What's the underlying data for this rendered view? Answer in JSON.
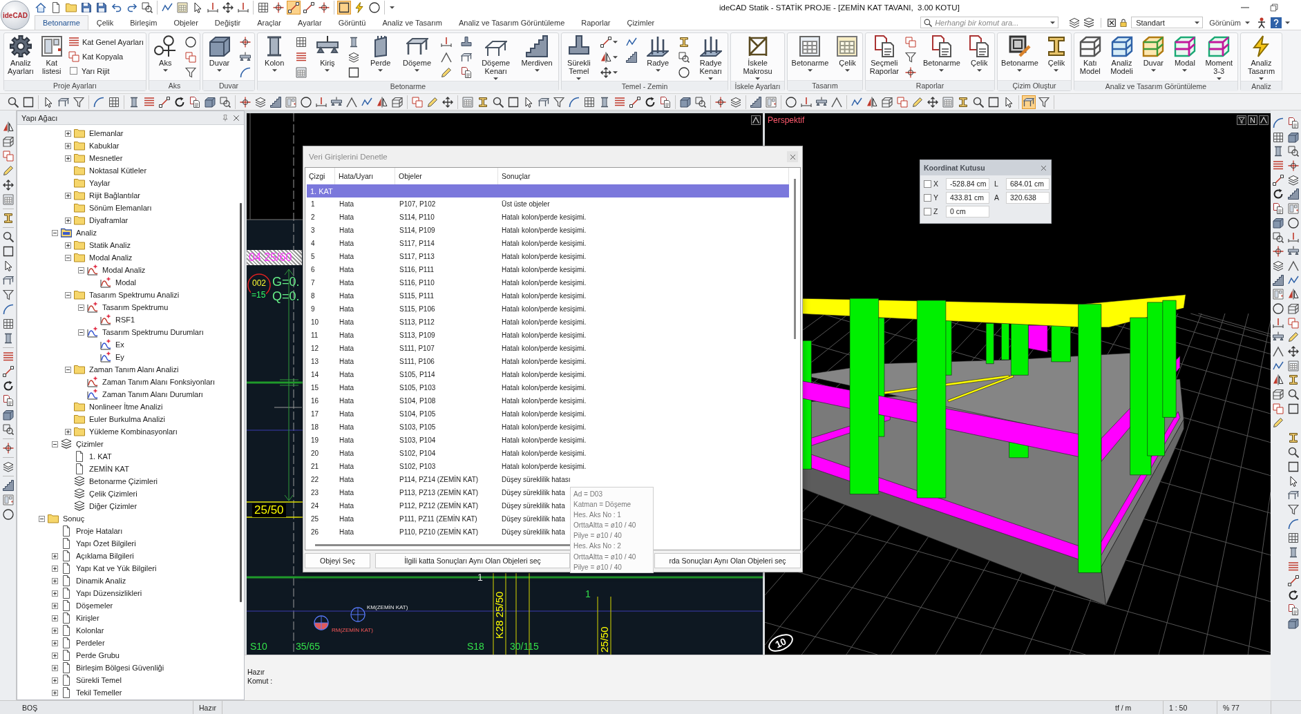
{
  "app": {
    "logo": "ideCAD",
    "title": "ideCAD Statik - STATİK PROJE - [ZEMİN KAT TAVANI,  3.00 KOTU]"
  },
  "quick_access_toolbar": {
    "groups": [
      {
        "buttons": [
          {
            "on": false
          },
          {
            "on": false
          },
          {
            "on": false
          },
          {
            "on": false
          },
          {
            "on": false
          },
          {
            "on": false
          },
          {
            "on": false
          },
          {
            "on": false
          }
        ]
      },
      {
        "buttons": [
          {
            "on": false
          },
          {
            "on": false
          },
          {
            "on": false
          },
          {
            "on": false
          },
          {
            "on": false
          },
          {
            "on": false
          }
        ]
      },
      {
        "buttons": [
          {
            "on": false
          },
          {
            "on": false
          },
          {
            "on": true
          },
          {
            "on": false
          },
          {
            "on": false
          }
        ]
      },
      {
        "buttons": [
          {
            "on": true
          },
          {
            "on": false
          },
          {
            "on": false
          }
        ]
      }
    ]
  },
  "ribbon_tabs": [
    {
      "label": "Betonarme",
      "selected": true
    },
    {
      "label": "Çelik",
      "selected": false
    },
    {
      "label": "Birleşim",
      "selected": false
    },
    {
      "label": "Objeler",
      "selected": false
    },
    {
      "label": "Değiştir",
      "selected": false
    },
    {
      "label": "Araçlar",
      "selected": false
    },
    {
      "label": "Ayarlar",
      "selected": false
    },
    {
      "label": "Görüntü",
      "selected": false
    },
    {
      "label": "Analiz ve Tasarım",
      "selected": false
    },
    {
      "label": "Analiz ve Tasarım Görüntüleme",
      "selected": false
    },
    {
      "label": "Raporlar",
      "selected": false
    },
    {
      "label": "Çizimler",
      "selected": false
    }
  ],
  "command_search": {
    "placeholder": "Herhangi bir komut ara..."
  },
  "style_selector": {
    "value": "Standart"
  },
  "view_menu": {
    "label": "Görünüm"
  },
  "ribbon_groups": [
    {
      "title": "Proje Ayarları",
      "items": [
        {
          "kind": "large",
          "label": "Analiz Ayarları",
          "dropdown": false
        },
        {
          "kind": "large",
          "label": "Kat listesi",
          "dropdown": false
        },
        {
          "kind": "stack",
          "rows": [
            {
              "kind": "small",
              "label": "Kat Genel Ayarları"
            },
            {
              "kind": "small",
              "label": "Kat Kopyala"
            },
            {
              "kind": "check",
              "label": "Yarı Rijit",
              "checked": false
            }
          ]
        }
      ]
    },
    {
      "title": "Aks",
      "items": [
        {
          "kind": "large",
          "label": "Aks",
          "dropdown": true
        },
        {
          "kind": "icon_column",
          "buttons": [
            {
              "dropdown": false
            },
            {
              "dropdown": false
            },
            {
              "dropdown": false
            }
          ]
        }
      ]
    },
    {
      "title": "Duvar",
      "items": [
        {
          "kind": "large",
          "label": "Duvar",
          "dropdown": true
        },
        {
          "kind": "icon_column",
          "buttons": [
            {
              "dropdown": false
            },
            {
              "dropdown": false
            },
            {
              "dropdown": false
            }
          ]
        }
      ]
    },
    {
      "title": "Betonarme",
      "items": [
        {
          "kind": "large",
          "label": "Kolon",
          "dropdown": true
        },
        {
          "kind": "icon_column",
          "buttons": [
            {
              "dropdown": false
            },
            {
              "dropdown": false
            },
            {
              "dropdown": false
            }
          ]
        },
        {
          "kind": "large",
          "label": "Kiriş",
          "dropdown": true
        },
        {
          "kind": "icon_column",
          "buttons": [
            {
              "dropdown": false
            },
            {
              "dropdown": false
            },
            {
              "dropdown": false
            }
          ]
        },
        {
          "kind": "large",
          "label": "Perde",
          "dropdown": true
        },
        {
          "kind": "large",
          "label": "Döşeme",
          "dropdown": true
        },
        {
          "kind": "icon_column",
          "buttons": [
            {
              "dropdown": false
            },
            {
              "dropdown": false
            },
            {
              "dropdown": false
            }
          ]
        },
        {
          "kind": "icon_column",
          "buttons": [
            {
              "dropdown": false
            },
            {
              "dropdown": false
            },
            {
              "dropdown": false
            }
          ]
        },
        {
          "kind": "large",
          "label": "Döşeme Kenarı",
          "dropdown": true
        },
        {
          "kind": "large",
          "label": "Merdiven",
          "dropdown": true
        }
      ]
    },
    {
      "title": "Temel - Zemin",
      "items": [
        {
          "kind": "large",
          "label": "Sürekli Temel",
          "dropdown": true
        },
        {
          "kind": "icon_column",
          "buttons": [
            {
              "dropdown": true
            },
            {
              "dropdown": true
            },
            {
              "dropdown": true
            }
          ]
        },
        {
          "kind": "icon_column",
          "buttons": [
            {
              "dropdown": false
            },
            {
              "dropdown": false
            }
          ]
        },
        {
          "kind": "large",
          "label": "Radye",
          "dropdown": true
        },
        {
          "kind": "icon_column",
          "buttons": [
            {
              "dropdown": false
            },
            {
              "dropdown": false
            },
            {
              "dropdown": false
            }
          ]
        },
        {
          "kind": "large",
          "label": "Radye Kenarı",
          "dropdown": true
        }
      ]
    },
    {
      "title": "İskele Ayarları",
      "items": [
        {
          "kind": "large",
          "label": "İskele Makrosu",
          "dropdown": true
        }
      ]
    },
    {
      "title": "Tasarım",
      "items": [
        {
          "kind": "large",
          "label": "Betonarme",
          "dropdown": true
        },
        {
          "kind": "large",
          "label": "Çelik",
          "dropdown": true
        }
      ]
    },
    {
      "title": "Raporlar",
      "items": [
        {
          "kind": "large",
          "label": "Seçmeli Raporlar",
          "dropdown": false
        },
        {
          "kind": "icon_column",
          "buttons": [
            {
              "dropdown": false
            },
            {
              "dropdown": false
            },
            {
              "dropdown": false
            }
          ]
        },
        {
          "kind": "large",
          "label": "Betonarme",
          "dropdown": true
        },
        {
          "kind": "large",
          "label": "Çelik",
          "dropdown": true
        }
      ]
    },
    {
      "title": "Çizim Oluştur",
      "items": [
        {
          "kind": "large",
          "label": "Betonarme",
          "dropdown": true
        },
        {
          "kind": "large",
          "label": "Çelik",
          "dropdown": true
        }
      ]
    },
    {
      "title": "Analiz ve Tasarım Görüntüleme",
      "items": [
        {
          "kind": "large",
          "label": "Katı Model",
          "dropdown": false
        },
        {
          "kind": "large",
          "label": "Analiz Modeli",
          "dropdown": false
        },
        {
          "kind": "large",
          "label": "Duvar",
          "dropdown": true
        },
        {
          "kind": "large",
          "label": "Modal",
          "dropdown": true
        },
        {
          "kind": "large",
          "label": "Moment 3-3",
          "dropdown": true
        }
      ]
    },
    {
      "title": "Analiz",
      "items": [
        {
          "kind": "large",
          "label": "Analiz Tasarım",
          "dropdown": true
        }
      ]
    }
  ],
  "toolbar": {
    "groups": [
      {
        "buttons": [
          {
            "on": false
          },
          {
            "on": false
          }
        ]
      },
      {
        "buttons": [
          {
            "on": false
          },
          {
            "on": false
          },
          {
            "on": false
          }
        ]
      },
      {
        "buttons": [
          {
            "on": false
          },
          {
            "on": false
          }
        ]
      },
      {
        "buttons": [
          {
            "on": false
          },
          {
            "on": false
          },
          {
            "on": false
          },
          {
            "on": false
          },
          {
            "on": false
          },
          {
            "on": false
          },
          {
            "on": false
          }
        ]
      },
      {
        "buttons": [
          {
            "on": false
          },
          {
            "on": false
          },
          {
            "on": false
          },
          {
            "on": false
          },
          {
            "on": false
          },
          {
            "on": false
          },
          {
            "on": false
          },
          {
            "on": false
          },
          {
            "on": false
          },
          {
            "on": false
          },
          {
            "on": false
          }
        ]
      },
      {
        "buttons": [
          {
            "on": false
          },
          {
            "on": false
          },
          {
            "on": false
          }
        ]
      },
      {
        "buttons": [
          {
            "on": false
          },
          {
            "on": false
          },
          {
            "on": false
          },
          {
            "on": false
          },
          {
            "on": false
          },
          {
            "on": false
          },
          {
            "on": false
          },
          {
            "on": false
          },
          {
            "on": false
          },
          {
            "on": false
          },
          {
            "on": false
          },
          {
            "on": false
          },
          {
            "on": false
          },
          {
            "on": false
          }
        ]
      },
      {
        "buttons": [
          {
            "on": false
          },
          {
            "on": false
          }
        ]
      },
      {
        "buttons": [
          {
            "on": false
          },
          {
            "on": false
          }
        ]
      },
      {
        "buttons": [
          {
            "on": false
          },
          {
            "on": false
          }
        ]
      },
      {
        "buttons": [
          {
            "on": false
          },
          {
            "on": false
          },
          {
            "on": false
          },
          {
            "on": false
          }
        ]
      },
      {
        "buttons": [
          {
            "on": false
          },
          {
            "on": false
          },
          {
            "on": false
          },
          {
            "on": false
          },
          {
            "on": false
          },
          {
            "on": false
          },
          {
            "on": false
          },
          {
            "on": false
          },
          {
            "on": false
          },
          {
            "on": false
          },
          {
            "on": false
          }
        ]
      },
      {
        "buttons": [
          {
            "on": true
          },
          {
            "on": false
          }
        ]
      }
    ]
  },
  "tree": {
    "title": "Yapı Ağacı",
    "items": [
      {
        "children": [
          {
            "children": [
              {
                "label": "Elemanlar",
                "kind": "folder",
                "expanded": false
              },
              {
                "label": "Kabuklar",
                "kind": "folder",
                "expanded": false
              },
              {
                "label": "Mesnetler",
                "kind": "folder",
                "expanded": false
              },
              {
                "label": "Noktasal Kütleler",
                "kind": "folder"
              },
              {
                "label": "Yaylar",
                "kind": "folder"
              },
              {
                "label": "Rijit Bağlantılar",
                "kind": "folder",
                "expanded": false
              },
              {
                "label": "Sönüm Elemanları",
                "kind": "folder"
              },
              {
                "label": "Diyaframlar",
                "kind": "folder",
                "expanded": false
              }
            ]
          },
          {
            "label": "Analiz",
            "kind": "analysis",
            "expanded": true,
            "children": [
              {
                "label": "Statik Analiz",
                "kind": "folder",
                "expanded": false
              },
              {
                "label": "Modal Analiz",
                "kind": "folder",
                "expanded": true,
                "children": [
                  {
                    "label": "Modal Analiz",
                    "kind": "function",
                    "expanded": true,
                    "children": [
                      {
                        "label": "Modal",
                        "kind": "function"
                      }
                    ]
                  }
                ]
              },
              {
                "label": "Tasarım Spektrumu Analizi",
                "kind": "folder",
                "expanded": true,
                "children": [
                  {
                    "label": "Tasarım Spektrumu",
                    "kind": "function",
                    "expanded": true,
                    "children": [
                      {
                        "label": "RSF1",
                        "kind": "function"
                      }
                    ]
                  },
                  {
                    "label": "Tasarım Spektrumu Durumları",
                    "kind": "case",
                    "expanded": true,
                    "children": [
                      {
                        "label": "Ex",
                        "kind": "case"
                      },
                      {
                        "label": "Ey",
                        "kind": "case"
                      }
                    ]
                  }
                ]
              },
              {
                "label": "Zaman Tanım Alanı Analizi",
                "kind": "folder",
                "expanded": true,
                "children": [
                  {
                    "label": "Zaman Tanım Alanı Fonksiyonları",
                    "kind": "function"
                  },
                  {
                    "label": "Zaman Tanım Alanı Durumları",
                    "kind": "case"
                  }
                ]
              },
              {
                "label": "Nonlineer İtme Analizi",
                "kind": "folder"
              },
              {
                "label": "Euler Burkulma Analizi",
                "kind": "folder"
              },
              {
                "label": "Yükleme Kombinasyonları",
                "kind": "folder",
                "expanded": false
              }
            ]
          },
          {
            "label": "Çizimler",
            "kind": "drawing-set",
            "expanded": true,
            "children": [
              {
                "label": "1. KAT",
                "kind": "sheet"
              },
              {
                "label": "ZEMİN KAT",
                "kind": "sheet"
              },
              {
                "label": "Betonarme Çizimleri",
                "kind": "drawing-set"
              },
              {
                "label": "Çelik Çizimleri",
                "kind": "drawing-set"
              },
              {
                "label": "Diğer Çizimler",
                "kind": "drawing-set"
              }
            ]
          }
        ]
      },
      {
        "label": "Sonuç",
        "kind": "folder",
        "expanded": true,
        "children": [
          {
            "label": "Proje Hataları",
            "kind": "report"
          },
          {
            "label": "Yapı Özet Bilgileri",
            "kind": "report"
          },
          {
            "label": "Açıklama Bilgileri",
            "kind": "report",
            "expanded": false
          },
          {
            "label": "Yapı Kat ve Yük Bilgileri",
            "kind": "report",
            "expanded": false
          },
          {
            "label": "Dinamik Analiz",
            "kind": "report",
            "expanded": false
          },
          {
            "label": "Yapı Düzensizlikleri",
            "kind": "report",
            "expanded": false
          },
          {
            "label": "Döşemeler",
            "kind": "report",
            "expanded": false
          },
          {
            "label": "Kirişler",
            "kind": "report",
            "expanded": false
          },
          {
            "label": "Kolonlar",
            "kind": "report",
            "expanded": false
          },
          {
            "label": "Perdeler",
            "kind": "report",
            "expanded": false
          },
          {
            "label": "Perde Grubu",
            "kind": "report",
            "expanded": false
          },
          {
            "label": "Birleşim Bölgesi Güvenliği",
            "kind": "report",
            "expanded": false
          },
          {
            "label": "Sürekli Temel",
            "kind": "report",
            "expanded": false
          },
          {
            "label": "Tekil Temeller",
            "kind": "report",
            "expanded": false
          }
        ]
      }
    ]
  },
  "plan_view": {
    "labels": [
      {
        "text": "04 25/60",
        "kind": "hatched"
      },
      {
        "text": "002",
        "kind": "slab-no"
      },
      {
        "text": "=15",
        "kind": "slab-value"
      },
      {
        "text": "G=0.",
        "kind": "load"
      },
      {
        "text": "Q=0.",
        "kind": "load"
      },
      {
        "text": "25/50",
        "kind": "boxed"
      },
      {
        "text": "1",
        "kind": "note"
      },
      {
        "text": "KM(ZEMİN KAT)",
        "kind": "km-mark"
      },
      {
        "text": "1",
        "kind": "dim"
      },
      {
        "text": "RM(ZEMİN KAT)",
        "kind": "rm-mark"
      },
      {
        "text": "K28 25/50",
        "kind": "vertical"
      },
      {
        "text": "25/50",
        "kind": "vertical"
      },
      {
        "text": "S10",
        "kind": "column"
      },
      {
        "text": "35/65",
        "kind": "column"
      },
      {
        "text": "S18",
        "kind": "column"
      },
      {
        "text": "30/115",
        "kind": "column"
      }
    ]
  },
  "perspective_view": {
    "label": "Perspektif",
    "corner_button": "N",
    "axis_bubble": "10"
  },
  "coordinate_box": {
    "title": "Koordinat Kutusu",
    "rows": [
      {
        "axis": "X",
        "checked": false,
        "value": "-528.84 cm",
        "pair_label": "L",
        "pair_value": "684.01 cm"
      },
      {
        "axis": "Y",
        "checked": false,
        "value": "433.81 cm",
        "pair_label": "A",
        "pair_value": "320.638"
      },
      {
        "axis": "Z",
        "checked": false,
        "value": "0 cm"
      }
    ]
  },
  "check_dialog": {
    "title": "Veri Girişlerini Denetle",
    "columns": [
      "Çizgi",
      "Hata/Uyarı",
      "Objeler",
      "Sonuçlar"
    ],
    "groups": [
      {
        "label": "1. KAT",
        "selected": true,
        "rows": [
          {
            "cells": [
              "1",
              "Hata",
              "P107, P102",
              "Üst üste objeler"
            ],
            "selected": false
          },
          {
            "cells": [
              "2",
              "Hata",
              "S114, P110",
              "Hatalı kolon/perde kesişimi."
            ],
            "selected": false
          },
          {
            "cells": [
              "3",
              "Hata",
              "S114, P109",
              "Hatalı kolon/perde kesişimi."
            ],
            "selected": false
          },
          {
            "cells": [
              "4",
              "Hata",
              "S117, P114",
              "Hatalı kolon/perde kesişimi."
            ],
            "selected": false
          },
          {
            "cells": [
              "5",
              "Hata",
              "S117, P113",
              "Hatalı kolon/perde kesişimi."
            ],
            "selected": false
          },
          {
            "cells": [
              "6",
              "Hata",
              "S116, P111",
              "Hatalı kolon/perde kesişimi."
            ],
            "selected": false
          },
          {
            "cells": [
              "7",
              "Hata",
              "S116, P110",
              "Hatalı kolon/perde kesişimi."
            ],
            "selected": false
          },
          {
            "cells": [
              "8",
              "Hata",
              "S115, P111",
              "Hatalı kolon/perde kesişimi."
            ],
            "selected": false
          },
          {
            "cells": [
              "9",
              "Hata",
              "S115, P106",
              "Hatalı kolon/perde kesişimi."
            ],
            "selected": false
          },
          {
            "cells": [
              "10",
              "Hata",
              "S113, P112",
              "Hatalı kolon/perde kesişimi."
            ],
            "selected": false
          },
          {
            "cells": [
              "11",
              "Hata",
              "S113, P109",
              "Hatalı kolon/perde kesişimi."
            ],
            "selected": false
          },
          {
            "cells": [
              "12",
              "Hata",
              "S111, P107",
              "Hatalı kolon/perde kesişimi."
            ],
            "selected": false
          },
          {
            "cells": [
              "13",
              "Hata",
              "S111, P106",
              "Hatalı kolon/perde kesişimi."
            ],
            "selected": false
          },
          {
            "cells": [
              "14",
              "Hata",
              "S105, P114",
              "Hatalı kolon/perde kesişimi."
            ],
            "selected": false
          },
          {
            "cells": [
              "15",
              "Hata",
              "S105, P103",
              "Hatalı kolon/perde kesişimi."
            ],
            "selected": false
          },
          {
            "cells": [
              "16",
              "Hata",
              "S104, P108",
              "Hatalı kolon/perde kesişimi."
            ],
            "selected": false
          },
          {
            "cells": [
              "17",
              "Hata",
              "S104, P105",
              "Hatalı kolon/perde kesişimi."
            ],
            "selected": false
          },
          {
            "cells": [
              "18",
              "Hata",
              "S103, P105",
              "Hatalı kolon/perde kesişimi."
            ],
            "selected": false
          },
          {
            "cells": [
              "19",
              "Hata",
              "S103, P104",
              "Hatalı kolon/perde kesişimi."
            ],
            "selected": false
          },
          {
            "cells": [
              "20",
              "Hata",
              "S102, P104",
              "Hatalı kolon/perde kesişimi."
            ],
            "selected": false
          },
          {
            "cells": [
              "21",
              "Hata",
              "S102, P103",
              "Hatalı kolon/perde kesişimi."
            ],
            "selected": false
          },
          {
            "cells": [
              "22",
              "Hata",
              "P114, PZ14 (ZEMİN KAT)",
              "Düşey süreklilik hatası"
            ],
            "selected": false
          },
          {
            "cells": [
              "23",
              "Hata",
              "P113, PZ13 (ZEMİN KAT)",
              "Düşey süreklilik hata"
            ],
            "selected": false
          },
          {
            "cells": [
              "24",
              "Hata",
              "P112, PZ12 (ZEMİN KAT)",
              "Düşey süreklilik hata"
            ],
            "selected": false
          },
          {
            "cells": [
              "25",
              "Hata",
              "P111, PZ11 (ZEMİN KAT)",
              "Düşey süreklilik hata"
            ],
            "selected": false
          },
          {
            "cells": [
              "26",
              "Hata",
              "P110, PZ10 (ZEMİN KAT)",
              "Düşey süreklilik hata"
            ],
            "selected": false
          }
        ]
      }
    ],
    "buttons": [
      "Objeyi Seç",
      "İlgili katta Sonuçları Aynı Olan Objeleri seç",
      "rda Sonuçları Aynı Olan Objeleri seç"
    ]
  },
  "tooltip": {
    "lines": [
      "Ad = D03",
      "Katman = Döşeme",
      "Hes. Aks No : 1",
      "OrttaAltta = ø10 / 40",
      "Pilye = ø10 / 40",
      "Hes. Aks No : 2",
      "OrttaAltta = ø10 / 40",
      "Pilye = ø10 / 40"
    ]
  },
  "command_line": {
    "lines": [
      "Hazır",
      "Komut :"
    ]
  },
  "status_bar": {
    "left": [
      "BOŞ",
      "Hazır"
    ],
    "right": [
      "tf / m",
      "1 : 50",
      "% 77"
    ]
  }
}
